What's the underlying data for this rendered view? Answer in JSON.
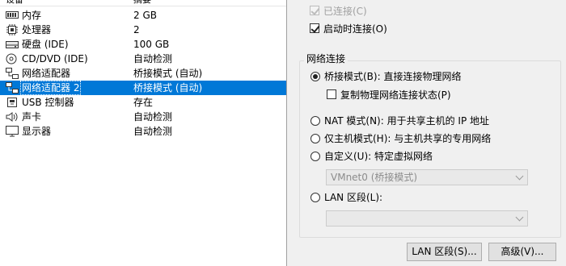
{
  "device_list": {
    "columns": {
      "device": "设备",
      "summary": "摘要"
    },
    "rows": [
      {
        "icon": "memory-icon",
        "name": "内存",
        "summary": "2 GB"
      },
      {
        "icon": "processor-icon",
        "name": "处理器",
        "summary": "2"
      },
      {
        "icon": "hard-disk-icon",
        "name": "硬盘 (IDE)",
        "summary": "100 GB"
      },
      {
        "icon": "cd-dvd-icon",
        "name": "CD/DVD (IDE)",
        "summary": "自动检测"
      },
      {
        "icon": "network-adapter-icon",
        "name": "网络适配器",
        "summary": "桥接模式 (自动)"
      },
      {
        "icon": "network-adapter-icon",
        "name": "网络适配器 2",
        "summary": "桥接模式 (自动)",
        "selected": true
      },
      {
        "icon": "usb-controller-icon",
        "name": "USB 控制器",
        "summary": "存在"
      },
      {
        "icon": "sound-card-icon",
        "name": "声卡",
        "summary": "自动检测"
      },
      {
        "icon": "display-icon",
        "name": "显示器",
        "summary": "自动检测"
      }
    ]
  },
  "device_status": {
    "connected": {
      "label": "已连接(C)",
      "checked": true,
      "enabled": false
    },
    "connect_at_power_on": {
      "label": "启动时连接(O)",
      "checked": true,
      "enabled": true
    }
  },
  "network_connection": {
    "title": "网络连接",
    "bridged": {
      "label": "桥接模式(B): 直接连接物理网络",
      "selected": true
    },
    "replicate_state": {
      "label": "复制物理网络连接状态(P)",
      "checked": false
    },
    "nat": {
      "label": "NAT 模式(N): 用于共享主机的 IP 地址",
      "selected": false
    },
    "host_only": {
      "label": "仅主机模式(H): 与主机共享的专用网络",
      "selected": false
    },
    "custom": {
      "label": "自定义(U): 特定虚拟网络",
      "selected": false
    },
    "custom_select": {
      "value": "VMnet0 (桥接模式)"
    },
    "lan_segment": {
      "label": "LAN 区段(L):",
      "selected": false
    },
    "lan_select": {
      "value": ""
    }
  },
  "buttons": {
    "lan_segments": "LAN 区段(S)...",
    "advanced": "高级(V)..."
  },
  "colors": {
    "selection": "#0078d7",
    "window": "#f0f0f0",
    "disabled_text": "#a0a0a0"
  }
}
